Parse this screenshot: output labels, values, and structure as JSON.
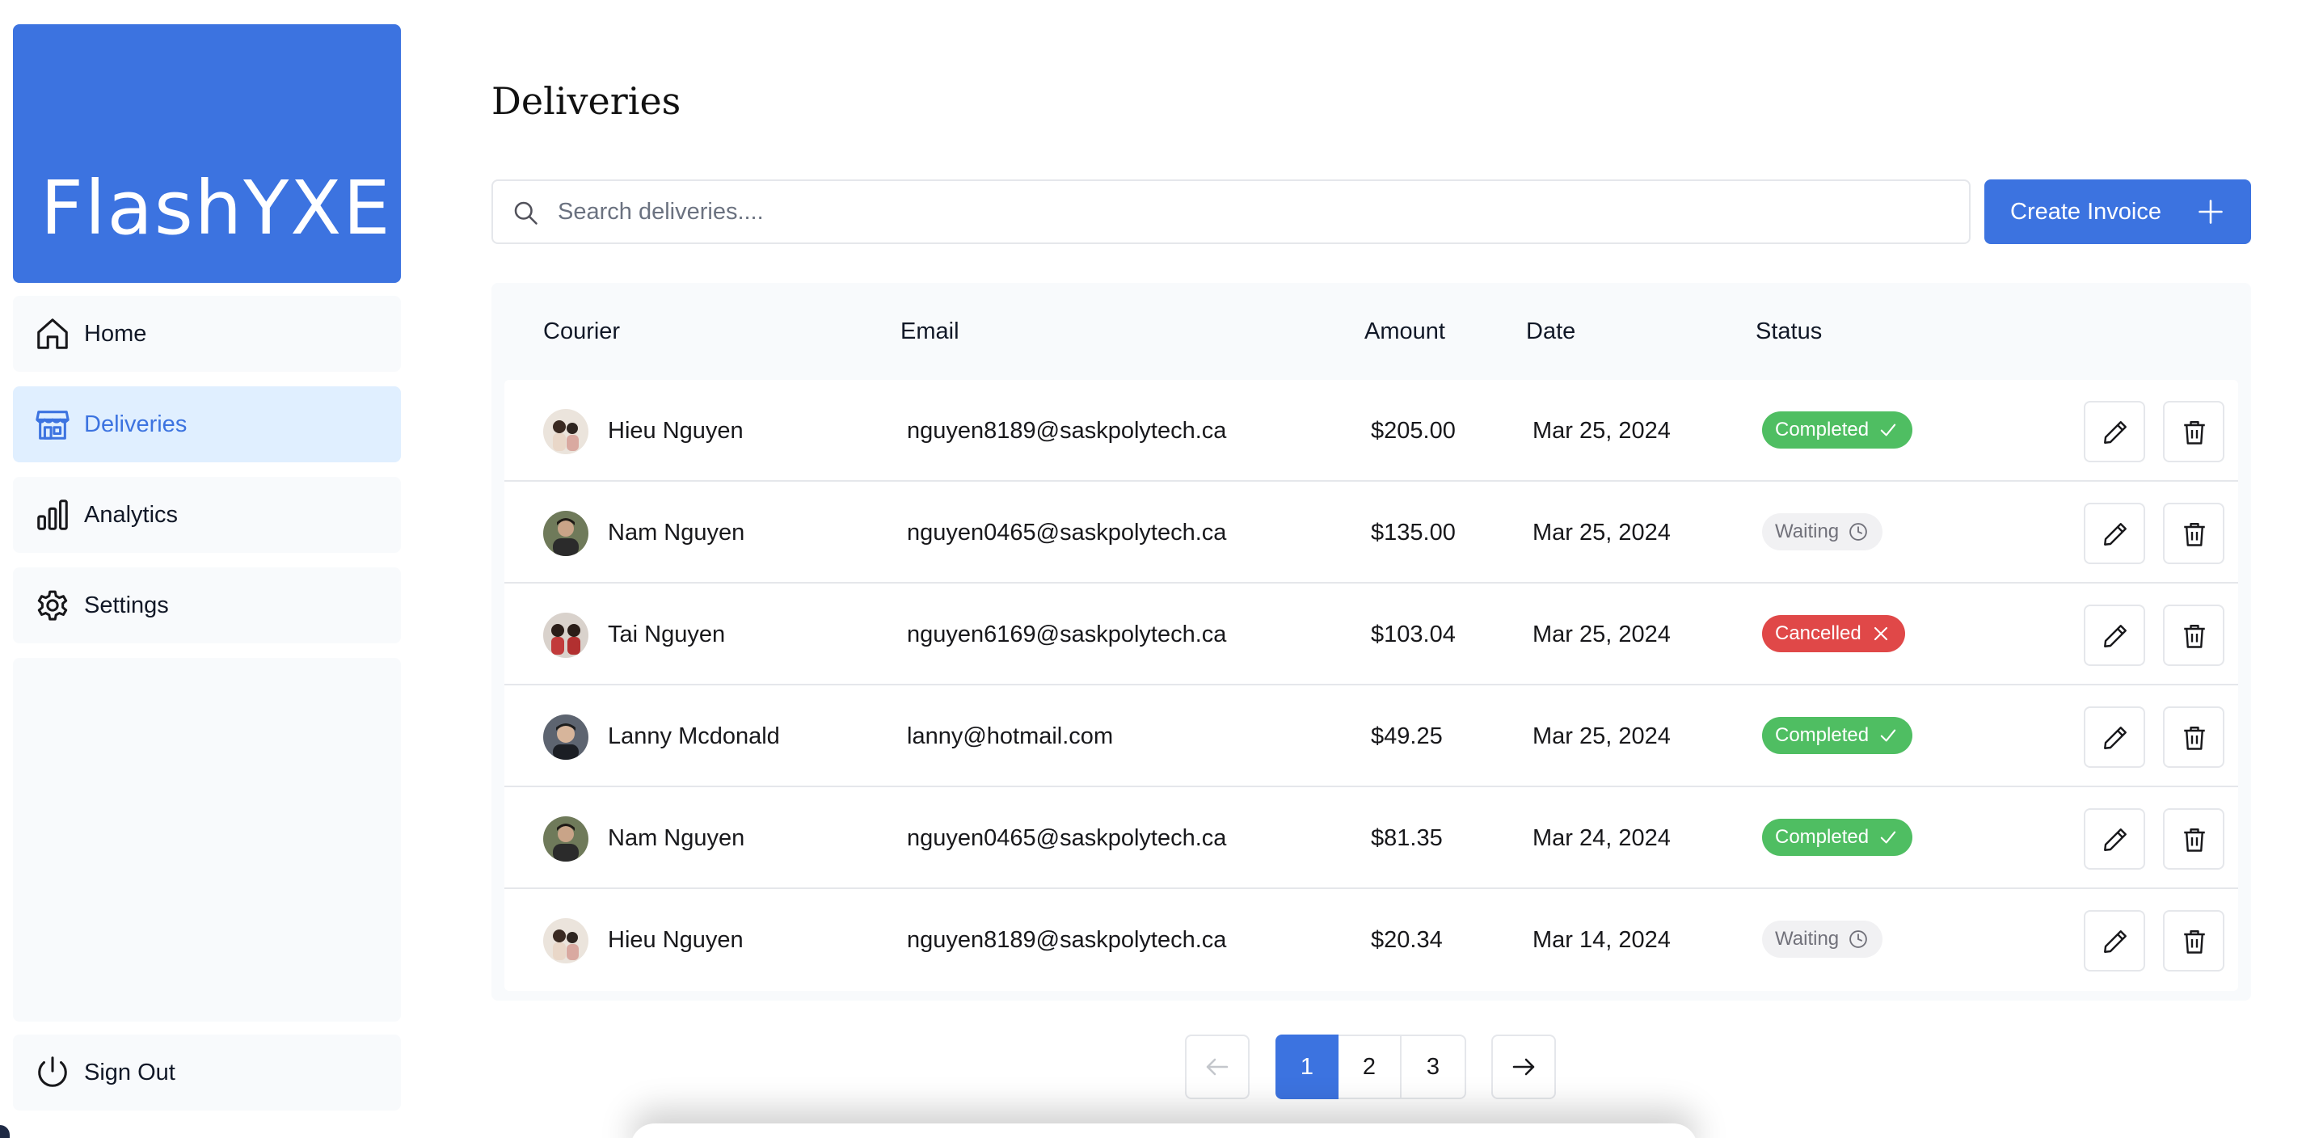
{
  "brand": {
    "name": "FlashYXE"
  },
  "nav": {
    "items": [
      {
        "label": "Home",
        "icon": "home-icon",
        "active": false
      },
      {
        "label": "Deliveries",
        "icon": "store-icon",
        "active": true
      },
      {
        "label": "Analytics",
        "icon": "bar-chart-icon",
        "active": false
      },
      {
        "label": "Settings",
        "icon": "gear-icon",
        "active": false
      }
    ],
    "sign_out": {
      "label": "Sign Out",
      "icon": "power-icon"
    }
  },
  "page": {
    "title": "Deliveries"
  },
  "search": {
    "placeholder": "Search deliveries....",
    "value": ""
  },
  "create_button": {
    "label": "Create Invoice"
  },
  "table": {
    "headers": [
      "Courier",
      "Email",
      "Amount",
      "Date",
      "Status"
    ],
    "rows": [
      {
        "name": "Hieu Nguyen",
        "email": "nguyen8189@saskpolytech.ca",
        "amount": "$205.00",
        "date": "Mar 25, 2024",
        "status": "Completed"
      },
      {
        "name": "Nam Nguyen",
        "email": "nguyen0465@saskpolytech.ca",
        "amount": "$135.00",
        "date": "Mar 25, 2024",
        "status": "Waiting"
      },
      {
        "name": "Tai Nguyen",
        "email": "nguyen6169@saskpolytech.ca",
        "amount": "$103.04",
        "date": "Mar 25, 2024",
        "status": "Cancelled"
      },
      {
        "name": "Lanny Mcdonald",
        "email": "lanny@hotmail.com",
        "amount": "$49.25",
        "date": "Mar 25, 2024",
        "status": "Completed"
      },
      {
        "name": "Nam Nguyen",
        "email": "nguyen0465@saskpolytech.ca",
        "amount": "$81.35",
        "date": "Mar 24, 2024",
        "status": "Completed"
      },
      {
        "name": "Hieu Nguyen",
        "email": "nguyen8189@saskpolytech.ca",
        "amount": "$20.34",
        "date": "Mar 14, 2024",
        "status": "Waiting"
      }
    ]
  },
  "pagination": {
    "pages": [
      "1",
      "2",
      "3"
    ],
    "current": "1"
  },
  "colors": {
    "accent": "#3c73e0",
    "active_nav_bg": "#e0efff",
    "completed": "#4fbe62",
    "waiting": "#f1f1f3",
    "cancelled": "#e04848"
  }
}
